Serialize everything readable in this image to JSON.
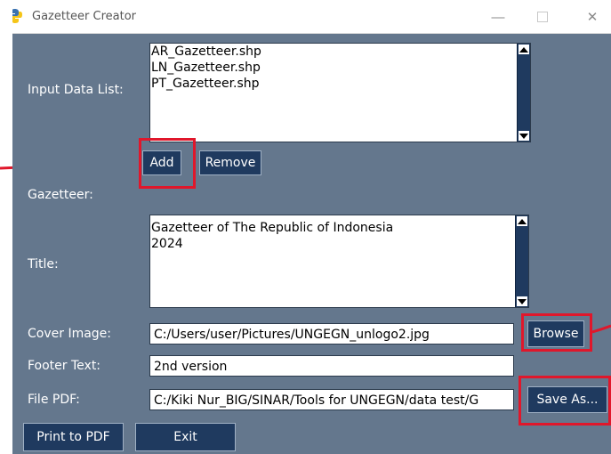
{
  "window": {
    "title": "Gazetteer Creator",
    "min_glyph": "—",
    "close_glyph": "✕"
  },
  "input_data": {
    "label": "Input Data List:",
    "items": [
      "AR_Gazetteer.shp",
      "LN_Gazetteer.shp",
      "PT_Gazetteer.shp"
    ],
    "add_label": "Add",
    "remove_label": "Remove"
  },
  "gazetteer": {
    "section_label": "Gazetteer:",
    "title_label": "Title:",
    "title_lines": [
      "Gazetteer of The Republic of Indonesia",
      "2024"
    ]
  },
  "cover_image": {
    "label": "Cover Image:",
    "value": "C:/Users/user/Pictures/UNGEGN_unlogo2.jpg",
    "browse_label": "Browse"
  },
  "footer": {
    "label": "Footer Text:",
    "value": "2nd version"
  },
  "file_pdf": {
    "label": "File PDF:",
    "value": "C:/Kiki Nur_BIG/SINAR/Tools for UNGEGN/data test/G",
    "save_as_label": "Save As..."
  },
  "actions": {
    "print_label": "Print to PDF",
    "exit_label": "Exit"
  },
  "colors": {
    "panel_bg": "#64778d",
    "button_bg": "#1f3a5f",
    "highlight": "#e0172b"
  }
}
